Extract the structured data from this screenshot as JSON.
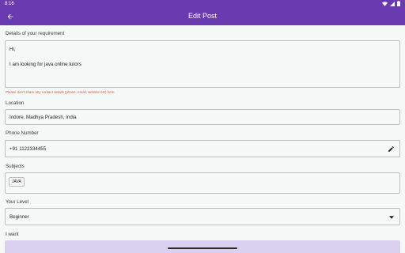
{
  "status_bar": {
    "time": "8:16"
  },
  "app_bar": {
    "title": "Edit Post",
    "back_icon": "arrow-back-icon"
  },
  "requirement": {
    "label": "Details of your requirement",
    "line1": "Hi,",
    "line2": "I am looking for java online tutors",
    "hint": "Please don't share any contact details (phone, email, website etc) here"
  },
  "location": {
    "label": "Location",
    "value": "Indore, Madhya Pradesh, India"
  },
  "phone": {
    "label": "Phone Number",
    "value": "+91 1122334455",
    "edit_icon": "pencil-icon"
  },
  "subjects": {
    "label": "Subjects",
    "chips": [
      "JAVA"
    ]
  },
  "level": {
    "label": "Your Level",
    "value": "Beginner"
  },
  "i_want": {
    "label": "I want"
  }
}
